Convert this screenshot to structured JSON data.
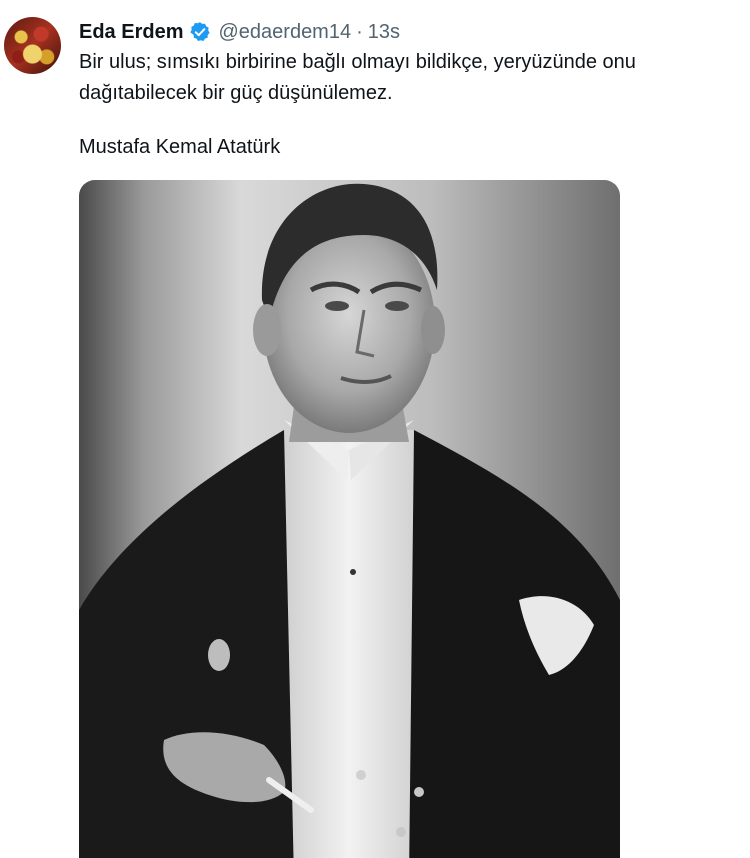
{
  "tweet": {
    "author_name": "Eda Erdem",
    "handle": "@edaerdem14",
    "separator": "·",
    "time": "13s",
    "text_line1": "Bir ulus; sımsıkı birbirine bağlı olmayı bildikçe, yeryüzünde onu",
    "text_line2": "dağıtabilecek bir güç düşünülemez.",
    "attribution": "Mustafa Kemal Atatürk"
  },
  "icons": {
    "verified": "verified-badge-icon"
  },
  "colors": {
    "verified": "#1d9bf0",
    "secondary_text": "#536471",
    "primary_text": "#0f1419"
  }
}
